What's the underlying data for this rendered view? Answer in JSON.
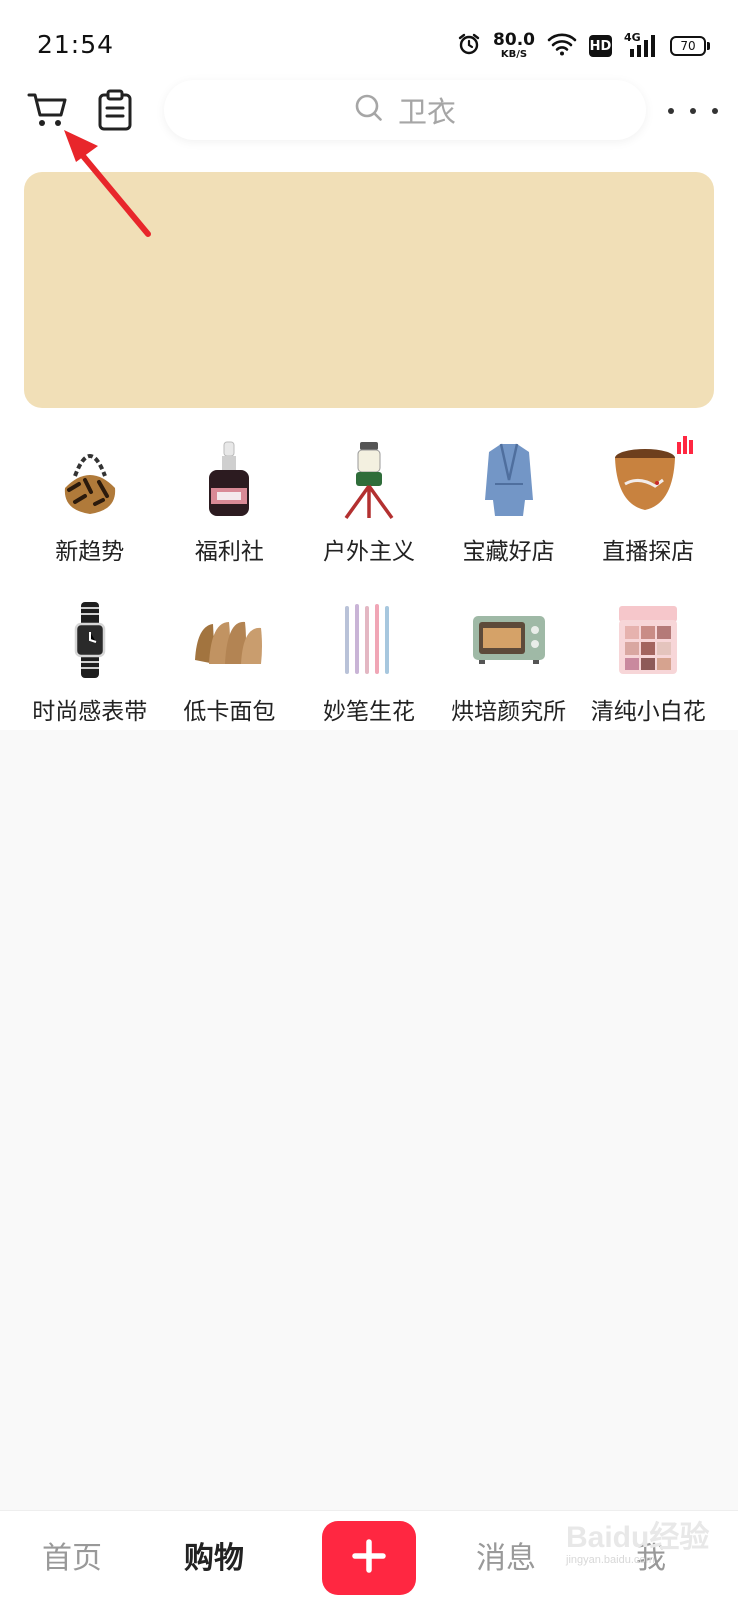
{
  "status_bar": {
    "time": "21:54",
    "speed_value": "80.0",
    "speed_unit": "KB/S",
    "hd": "HD",
    "network": "4G",
    "battery": "70"
  },
  "header": {
    "search_placeholder": "卫衣"
  },
  "categories": [
    {
      "label": "新趋势",
      "icon": "handbag-icon"
    },
    {
      "label": "福利社",
      "icon": "serum-bottle-icon"
    },
    {
      "label": "户外主义",
      "icon": "camping-lantern-icon"
    },
    {
      "label": "宝藏好店",
      "icon": "denim-jacket-icon"
    },
    {
      "label": "直播探店",
      "icon": "tea-cup-icon"
    },
    {
      "label": "时尚感表带",
      "icon": "watch-icon"
    },
    {
      "label": "低卡面包",
      "icon": "bread-icon"
    },
    {
      "label": "妙笔生花",
      "icon": "pens-icon"
    },
    {
      "label": "烘培颜究所",
      "icon": "oven-icon"
    },
    {
      "label": "清纯小白花",
      "icon": "eyeshadow-palette-icon"
    }
  ],
  "bottom_nav": {
    "home": "首页",
    "shop": "购物",
    "messages": "消息",
    "me": "我"
  },
  "colors": {
    "accent": "#ff2741",
    "banner": "#f1dfb7",
    "annotation": "#e8262b"
  },
  "watermark": {
    "brand": "Baidu经验",
    "site": "jingyan.baidu.com"
  }
}
